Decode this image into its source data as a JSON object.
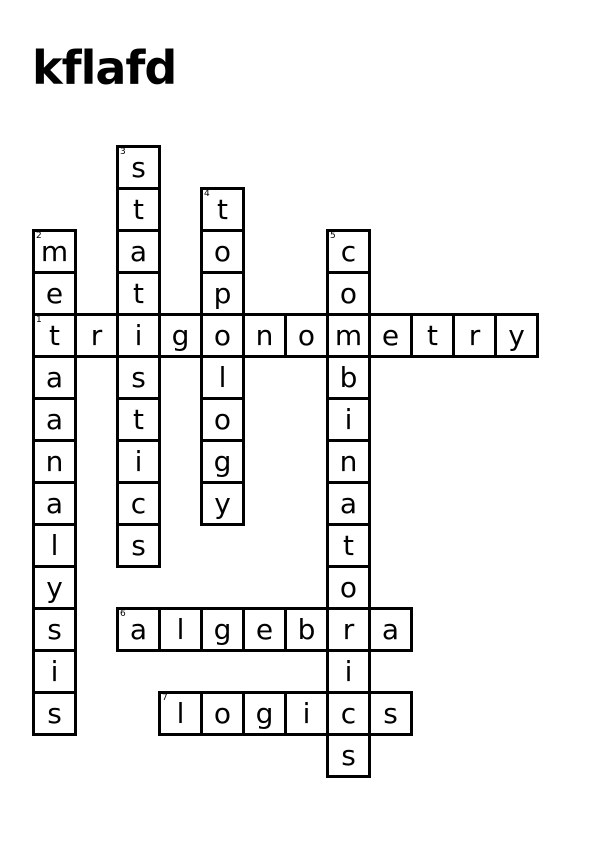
{
  "title": "kflafd",
  "words": [
    {
      "number": "1",
      "answer": "trigonometry",
      "direction": "across",
      "row": 4,
      "col": 0
    },
    {
      "number": "2",
      "answer": "metaanalysis",
      "direction": "down",
      "row": 2,
      "col": 0
    },
    {
      "number": "3",
      "answer": "statistics",
      "direction": "down",
      "row": 0,
      "col": 2
    },
    {
      "number": "4",
      "answer": "topology",
      "direction": "down",
      "row": 1,
      "col": 4
    },
    {
      "number": "5",
      "answer": "combinatorics",
      "direction": "down",
      "row": 2,
      "col": 7
    },
    {
      "number": "6",
      "answer": "algebra",
      "direction": "across",
      "row": 11,
      "col": 2
    },
    {
      "number": "7",
      "answer": "logics",
      "direction": "across",
      "row": 13,
      "col": 3
    }
  ]
}
